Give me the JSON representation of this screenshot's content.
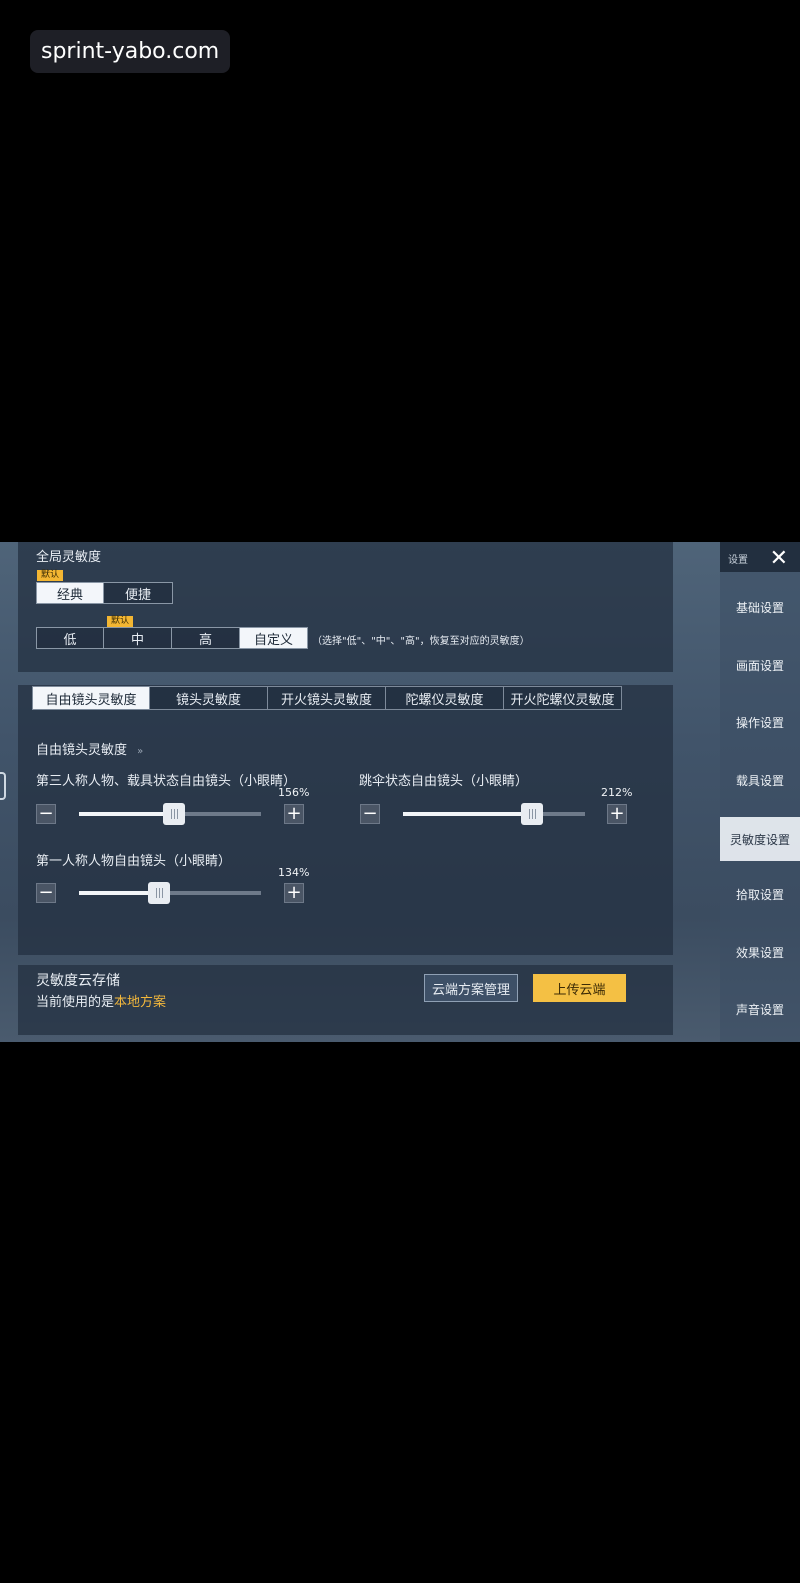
{
  "watermark": "sprint-yabo.com",
  "global": {
    "title": "全局灵敏度",
    "default_tag": "默认",
    "mode_options": [
      "经典",
      "便捷"
    ],
    "mode_selected": "经典",
    "level_default_tag": "默认",
    "levels": [
      "低",
      "中",
      "高",
      "自定义"
    ],
    "level_selected": "自定义",
    "level_hint": "（选择\"低\"、\"中\"、\"高\"，恢复至对应的灵敏度）"
  },
  "tabs": [
    "自由镜头灵敏度",
    "镜头灵敏度",
    "开火镜头灵敏度",
    "陀螺仪灵敏度",
    "开火陀螺仪灵敏度"
  ],
  "tab_selected": "自由镜头灵敏度",
  "section": {
    "title": "自由镜头灵敏度",
    "arrow": "»"
  },
  "sliders": [
    {
      "label": "第三人称人物、载具状态自由镜头（小眼睛）",
      "value_text": "156%",
      "fraction": 0.52
    },
    {
      "label": "跳伞状态自由镜头（小眼睛）",
      "value_text": "212%",
      "fraction": 0.71
    },
    {
      "label": "第一人称人物自由镜头（小眼睛）",
      "value_text": "134%",
      "fraction": 0.44
    }
  ],
  "cloud": {
    "title": "灵敏度云存储",
    "current_prefix": "当前使用的是",
    "current_value": "本地方案",
    "manage_label": "云端方案管理",
    "upload_label": "上传云端"
  },
  "sidebar": {
    "title": "设置",
    "items": [
      "基础设置",
      "画面设置",
      "操作设置",
      "载具设置",
      "灵敏度设置",
      "拾取设置",
      "效果设置",
      "声音设置"
    ],
    "selected": "灵敏度设置"
  },
  "icons": {
    "minus": "−",
    "plus": "+",
    "close": "✕"
  }
}
